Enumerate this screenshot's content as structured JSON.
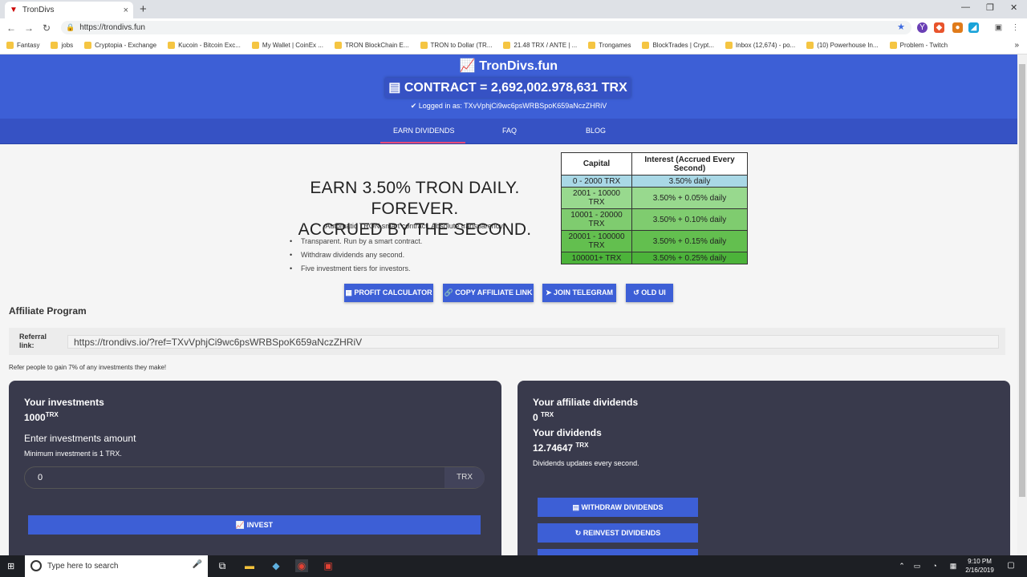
{
  "browser": {
    "tab_title": "TronDivs",
    "tab_close": "×",
    "new_tab": "+",
    "url": "https://trondivs.fun",
    "bookmarks": [
      "Fantasy",
      "jobs",
      "Cryptopia - Exchange",
      "Kucoin - Bitcoin Exc...",
      "My Wallet | CoinEx ...",
      "TRON BlockChain E...",
      "TRON to Dollar (TR...",
      "21.48 TRX / ANTE | ...",
      "Trongames",
      "BlockTrades | Crypt...",
      "Inbox (12,674) - po...",
      "(10) Powerhouse In...",
      "Problem - Twitch"
    ],
    "more_bookmarks": "»"
  },
  "header": {
    "title": "TronDivs.fun",
    "contract_label": "CONTRACT = 2,692,002.978,631 TRX",
    "logged_in": "Logged in as: TXvVphjCi9wc6psWRBSpoK659aNczZHRiV"
  },
  "nav": {
    "items": [
      "EARN DIVIDENDS",
      "FAQ",
      "BLOG"
    ]
  },
  "hero": {
    "title_line1": "EARN 3.50% TRON DAILY. FOREVER.",
    "title_line2": "ACCRUED BY THE SECOND.",
    "subtitle": "Automatic TRON smart contract. Absolute transparency.",
    "features": [
      "Transparent. Run by a smart contract.",
      "Withdraw dividends any second.",
      "Five investment tiers for investors."
    ]
  },
  "tiers": {
    "headers": [
      "Capital",
      "Interest (Accrued Every Second)"
    ],
    "rows": [
      {
        "capital": "0 - 2000 TRX",
        "interest": "3.50% daily",
        "color": "#a9d8e6"
      },
      {
        "capital": "2001 - 10000 TRX",
        "interest": "3.50% + 0.05% daily",
        "color": "#98d98e"
      },
      {
        "capital": "10001 - 20000 TRX",
        "interest": "3.50% + 0.10% daily",
        "color": "#7fcc6f"
      },
      {
        "capital": "20001 - 100000 TRX",
        "interest": "3.50% + 0.15% daily",
        "color": "#63bf4f"
      },
      {
        "capital": "100001+ TRX",
        "interest": "3.50% + 0.25% daily",
        "color": "#4cb33a"
      }
    ]
  },
  "buttons": {
    "profit_calculator": "PROFIT CALCULATOR",
    "copy_affiliate": "COPY AFFILIATE LINK",
    "join_telegram": "JOIN TELEGRAM",
    "old_ui": "OLD UI"
  },
  "affiliate": {
    "heading": "Affiliate Program",
    "referral_label": "Referral link:",
    "referral_value": "https://trondivs.io/?ref=TXvVphjCi9wc6psWRBSpoK659aNczZHRiV",
    "note": "Refer people to gain 7% of any investments they make!"
  },
  "investments": {
    "heading": "Your investments",
    "amount": "1000",
    "unit": "TRX",
    "enter_label": "Enter investments amount",
    "minimum": "Minimum investment is 1 TRX.",
    "input_value": "0",
    "input_unit": "TRX",
    "invest_button": "INVEST"
  },
  "dividends": {
    "affiliate_heading": "Your affiliate dividends",
    "affiliate_amount": "0",
    "unit": "TRX",
    "dividends_heading": "Your dividends",
    "dividends_amount": "12.74647",
    "update_note": "Dividends updates every second.",
    "withdraw_button": "WITHDRAW DIVIDENDS",
    "reinvest_button": "REINVEST DIVIDENDS"
  },
  "taskbar": {
    "search_placeholder": "Type here to search",
    "time": "9:10 PM",
    "date": "2/16/2019"
  },
  "colors": {
    "primary": "#3d5fd6",
    "nav": "#3652c4",
    "card": "#393a4c",
    "accent_underline": "#e84a78"
  }
}
